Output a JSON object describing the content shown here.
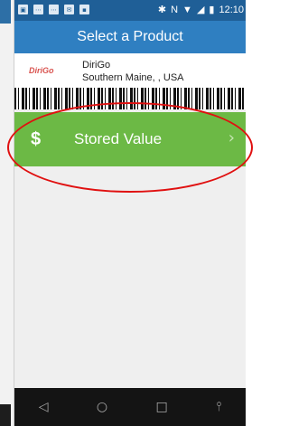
{
  "statusbar": {
    "left_icons": [
      "sim-icon",
      "signal-bars-icon",
      "signal-bars-icon",
      "mail-icon",
      "image-icon"
    ],
    "right_icons": [
      "bluetooth-icon",
      "nfc-icon",
      "wifi-icon",
      "signal-icon",
      "battery-icon"
    ],
    "time": "12:10"
  },
  "appbar": {
    "title": "Select a Product"
  },
  "merchant": {
    "logo_text": "DiriGo",
    "name": "DiriGo",
    "location": "Southern Maine,  , USA"
  },
  "product": {
    "icon_symbol": "$",
    "label": "Stored Value",
    "chevron": "›"
  },
  "navbar": {
    "back": "◁",
    "home": "○",
    "recents": "□",
    "extra": "⫯"
  },
  "colors": {
    "statusbar": "#1f5f97",
    "appbar": "#2f7fc1",
    "product_bg": "#6cb945",
    "annotation": "#e01010"
  }
}
